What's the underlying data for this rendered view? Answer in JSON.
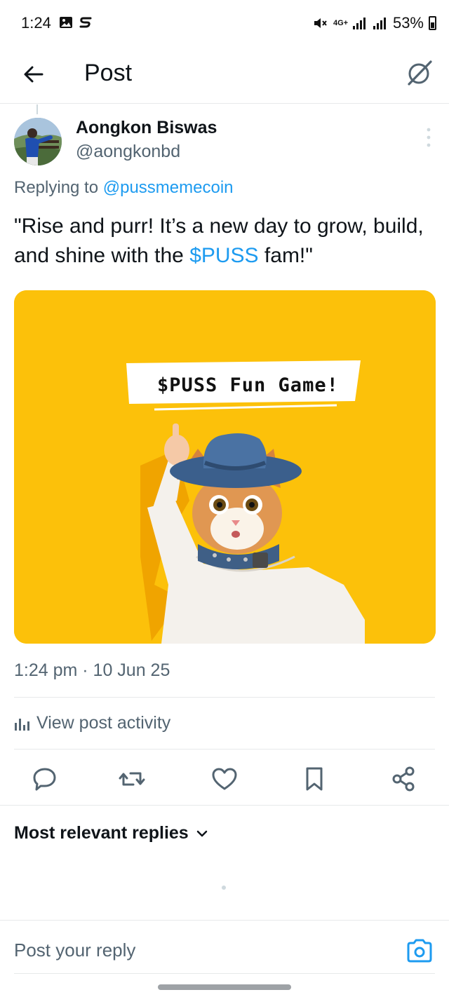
{
  "status_bar": {
    "time": "1:24",
    "left_icons": [
      "gallery-icon",
      "s-app-icon"
    ],
    "right_icons": [
      "mute-icon",
      "network-4g-icon",
      "signal-icon",
      "signal-icon"
    ],
    "network": "4G+",
    "battery": "53%"
  },
  "header": {
    "title": "Post",
    "back_icon": "arrow-left-icon",
    "grok_icon": "grok-icon"
  },
  "post": {
    "author_name": "Aongkon Biswas",
    "author_handle": "@aongkonbd",
    "replying_prefix": "Replying to",
    "replying_to": "@pussmemecoin",
    "text_before": "\"Rise and purr! It’s a new day to grow, build, and shine with the",
    "cashtag": "$PUSS",
    "text_after": "fam!\"",
    "image_banner": "$PUSS Fun Game!",
    "timestamp": "1:24 pm · 10 Jun 25",
    "view_activity": "View post activity"
  },
  "actions": [
    "reply-icon",
    "repost-icon",
    "like-icon",
    "bookmark-icon",
    "share-icon"
  ],
  "replies": {
    "sort_label": "Most relevant replies"
  },
  "composer": {
    "placeholder": "Post your reply"
  },
  "colors": {
    "accent": "#1d9bf0",
    "text": "#0f1419",
    "secondary": "#536471",
    "image_background": "#fcc10a"
  }
}
